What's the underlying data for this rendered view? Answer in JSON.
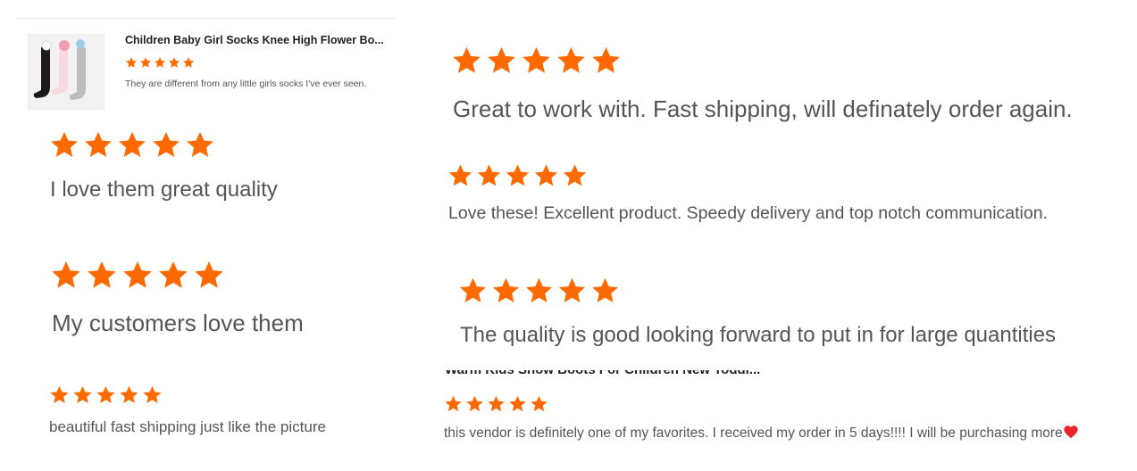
{
  "product_card": {
    "title": "Children Baby Girl Socks Knee High Flower Bo...",
    "review": "They are different from any little girls socks I've ever seen.",
    "rating": 5
  },
  "reviews": [
    {
      "text": "I love them great quality",
      "rating": 5
    },
    {
      "text": "My customers love them",
      "rating": 5
    },
    {
      "text": "beautiful fast shipping just like the picture",
      "rating": 5
    },
    {
      "text": "Great to work with. Fast shipping, will definately order again.",
      "rating": 5
    },
    {
      "text": "Love these! Excellent product. Speedy delivery and top notch communication.",
      "rating": 5
    },
    {
      "text": "The quality is good looking forward to put in for large quantities",
      "rating": 5
    },
    {
      "text": "this vendor is definitely one of my favorites. I received my order in 5 days!!!! I will be purchasing more",
      "rating": 5
    }
  ],
  "partial_title": "Warm Kids Snow Boots For Children New Toddl...",
  "colors": {
    "star": "#ff6a00",
    "heart": "#e8262c",
    "text": "#555555"
  },
  "icons": {
    "star": "star-icon",
    "heart": "heart-icon"
  }
}
